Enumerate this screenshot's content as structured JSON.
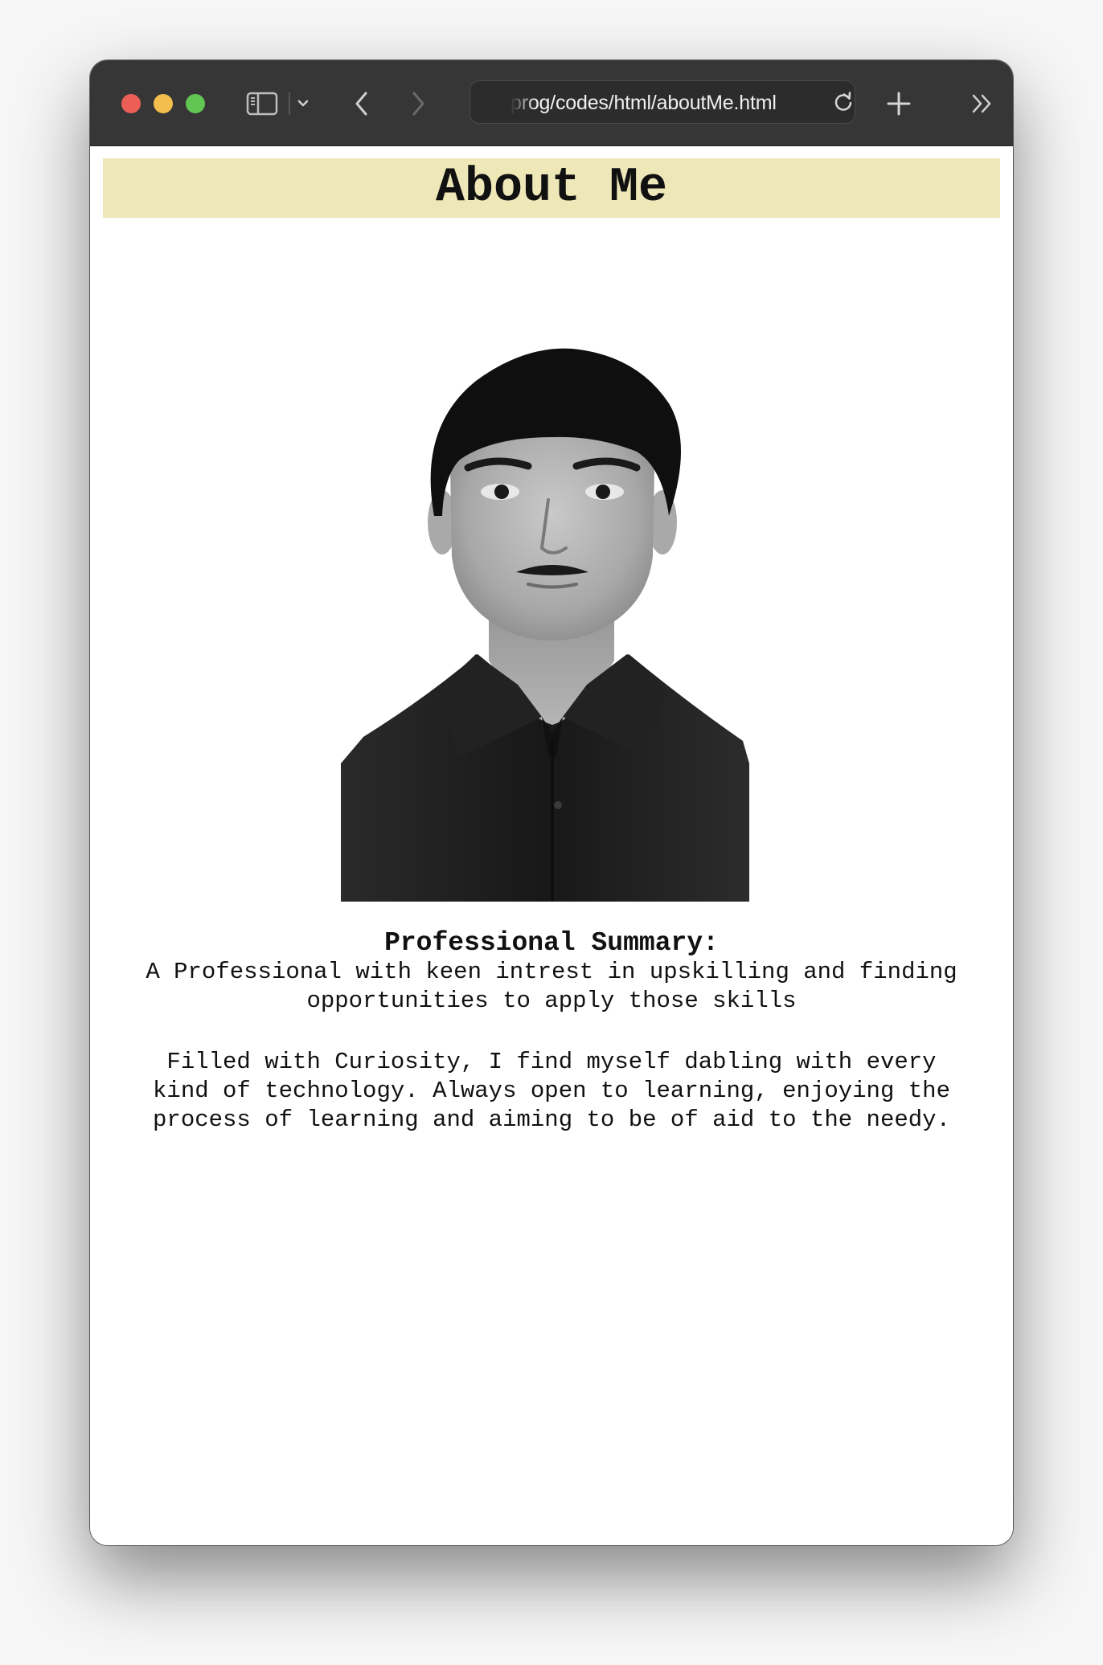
{
  "browser": {
    "url": "prog/codes/html/aboutMe.html",
    "icons": {
      "close": "close-traffic-light",
      "minimize": "minimize-traffic-light",
      "maximize": "maximize-traffic-light",
      "sidebar": "sidebar-icon",
      "sidebar_menu": "chevron-down-icon",
      "back": "chevron-left-icon",
      "forward": "chevron-right-icon",
      "reload": "reload-icon",
      "new_tab": "plus-icon",
      "more": "double-chevron-right-icon"
    },
    "colors": {
      "close": "#ec5f57",
      "minimize": "#f4be4f",
      "maximize": "#62c655",
      "toolbar": "#363636"
    }
  },
  "page": {
    "heading": "About Me",
    "heading_background": "#eee7b8",
    "photo": "portrait-photo",
    "summary_title": "Professional Summary:",
    "summary_text": "A Professional with keen intrest in upskilling and finding\nopportunities to apply those skills",
    "bio_text": "Filled with Curiosity, I find myself dabling with every\nkind of technology. Always open to learning, enjoying the\nprocess of learning and aiming to be of aid to the needy."
  }
}
